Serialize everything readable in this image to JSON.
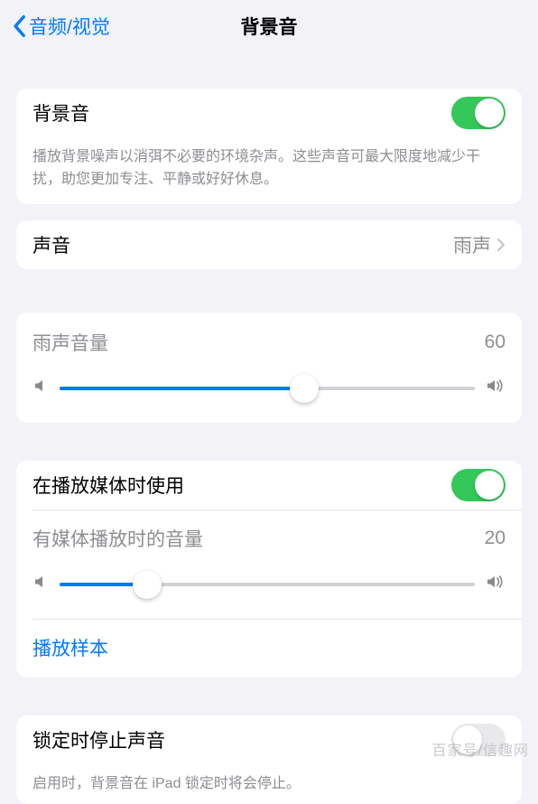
{
  "nav": {
    "back_label": "音频/视觉",
    "title": "背景音"
  },
  "main_toggle": {
    "label": "背景音",
    "enabled": true,
    "description": "播放背景噪声以消弭不必要的环境杂声。这些声音可最大限度地减少干扰，助您更加专注、平静或好好休息。"
  },
  "sound_row": {
    "label": "声音",
    "value": "雨声"
  },
  "volume": {
    "label": "雨声音量",
    "value": 60,
    "percent": "59%"
  },
  "media": {
    "toggle_label": "在播放媒体时使用",
    "toggle_enabled": true,
    "volume_label": "有媒体播放时的音量",
    "volume_value": 20,
    "percent": "21%",
    "sample_link": "播放样本"
  },
  "lock": {
    "label": "锁定时停止声音",
    "enabled": false,
    "description": "启用时，背景音在 iPad 锁定时将会停止。"
  },
  "watermark": "百家号/信趣网"
}
